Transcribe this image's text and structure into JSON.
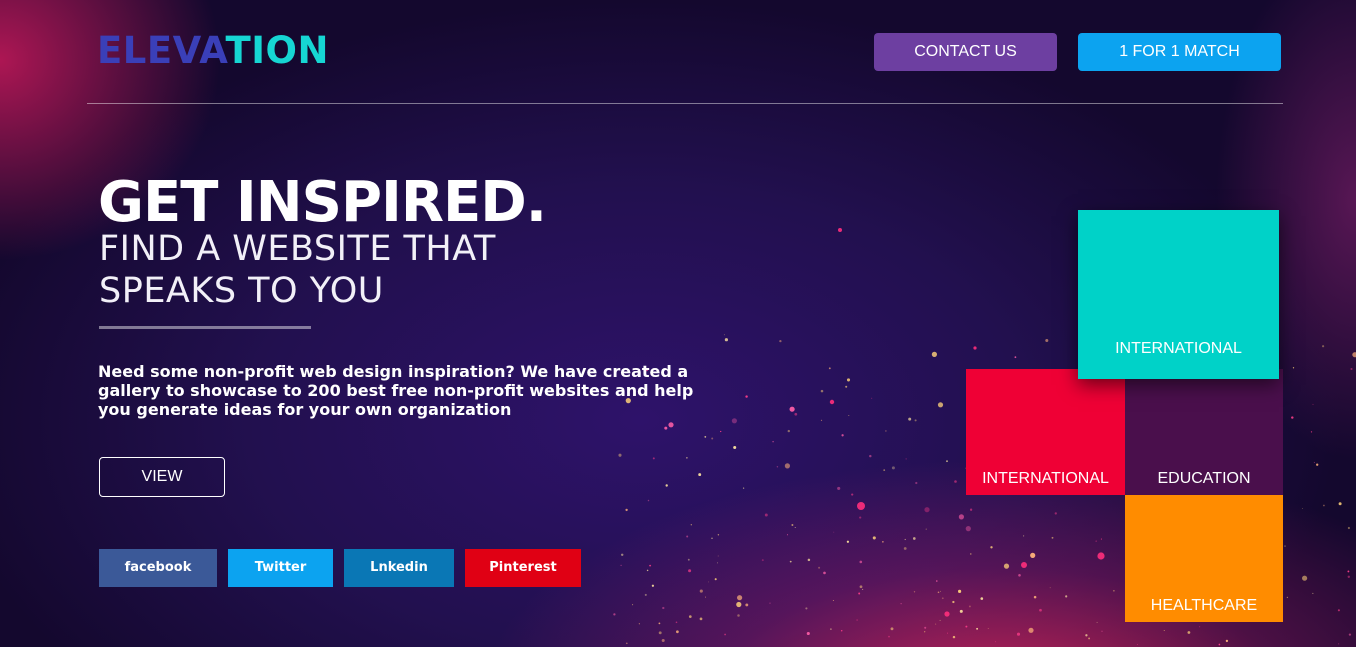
{
  "brand": {
    "logo_part1": "ELEVA",
    "logo_part2": "TION",
    "logo_color_primary": "#3a3fb8",
    "logo_color_accent": "#16d6d3"
  },
  "header": {
    "contact_label": "CONTACT US",
    "contact_color": "#6d3fa1",
    "match_label": "1 FOR 1 MATCH",
    "match_color": "#0ca3f0"
  },
  "hero": {
    "title": "GET INSPIRED.",
    "subtitle": "FIND A WEBSITE THAT SPEAKS TO YOU",
    "description": "Need some non-profit web design inspiration? We have created a gallery to showcase to 200 best free non-profit websites and help you generate ideas for your own organization",
    "view_label": "VIEW"
  },
  "social": [
    {
      "label": "facebook",
      "color": "#3b5998",
      "icon": "facebook-icon"
    },
    {
      "label": "Twitter",
      "color": "#0ca3f0",
      "icon": "twitter-icon"
    },
    {
      "label": "Lnkedin",
      "color": "#0a77b5",
      "icon": "linkedin-icon"
    },
    {
      "label": "Pinterest",
      "color": "#e00014",
      "icon": "pinterest-icon"
    }
  ],
  "categories": [
    {
      "label": "INTERNATIONAL",
      "color": "#00d2c8"
    },
    {
      "label": "INTERNATIONAL",
      "color": "#ef0035"
    },
    {
      "label": "EDUCATION",
      "color": "#4a0f4c"
    },
    {
      "label": "HEALTHCARE",
      "color": "#ff8c00"
    }
  ]
}
